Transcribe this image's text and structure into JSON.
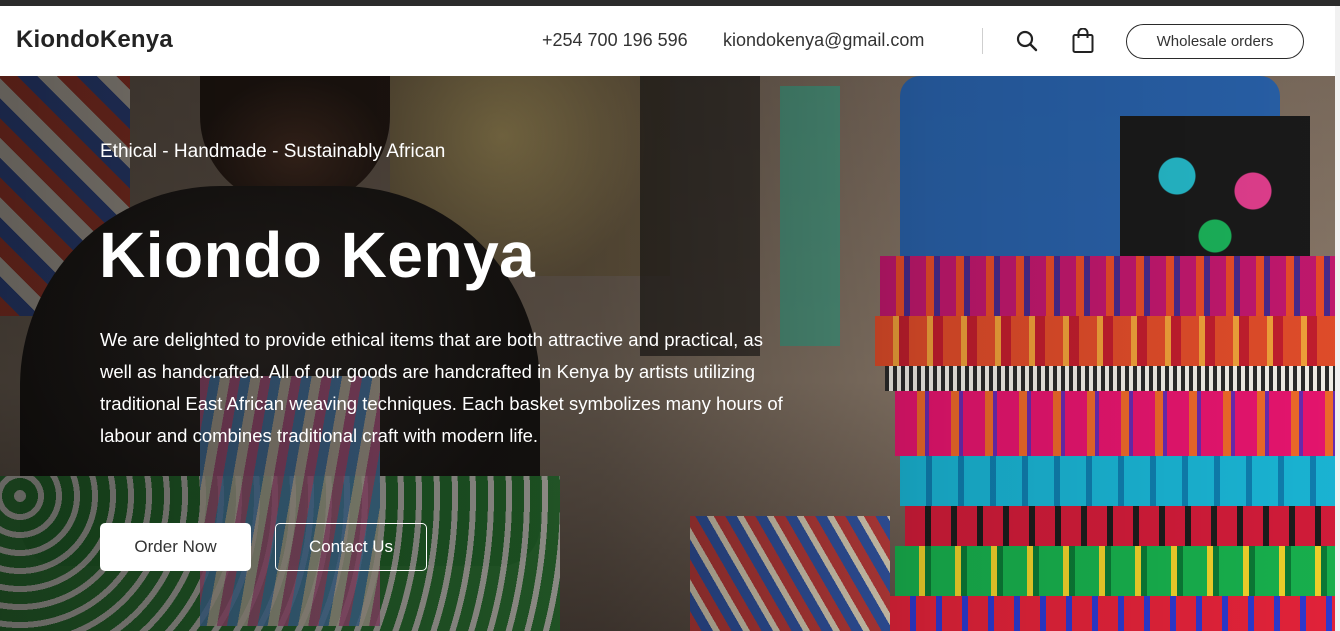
{
  "header": {
    "brand": "KiondoKenya",
    "phone": "+254 700 196 596",
    "email": "kiondokenya@gmail.com",
    "search_icon": "search-icon",
    "bag_icon": "shopping-bag-icon",
    "wholesale_label": "Wholesale orders"
  },
  "hero": {
    "tagline": "Ethical - Handmade - Sustainably African",
    "title": "Kiondo Kenya",
    "description": "We are delighted to provide ethical items that are both attractive and practical, as well as handcrafted. All of our goods are handcrafted in Kenya by artists utilizing traditional East African weaving techniques. Each basket symbolizes many hours of labour and combines traditional craft with modern life.",
    "order_label": "Order Now",
    "contact_label": "Contact Us"
  },
  "colors": {
    "header_bg": "#ffffff",
    "brand_text": "#232323",
    "top_strip": "#2b2b2b"
  }
}
